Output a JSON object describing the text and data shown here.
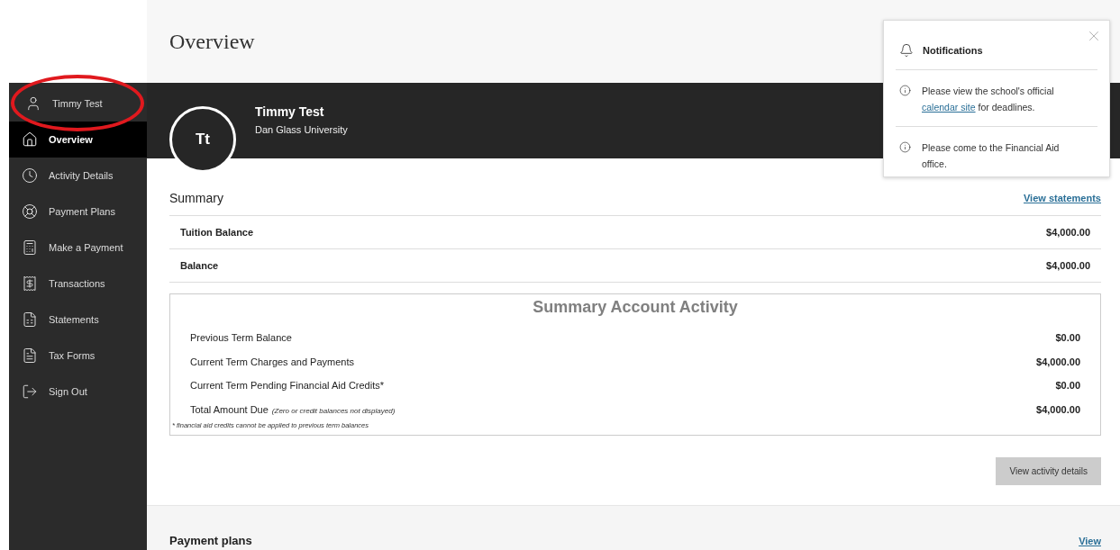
{
  "sidebar": {
    "user": "Timmy Test",
    "items": [
      {
        "label": "Overview",
        "selected": true
      },
      {
        "label": "Activity Details",
        "selected": false
      },
      {
        "label": "Payment Plans",
        "selected": false
      },
      {
        "label": "Make a Payment",
        "selected": false
      },
      {
        "label": "Transactions",
        "selected": false
      },
      {
        "label": "Statements",
        "selected": false
      },
      {
        "label": "Tax Forms",
        "selected": false
      },
      {
        "label": "Sign Out",
        "selected": false
      }
    ]
  },
  "page_title": "Overview",
  "profile": {
    "initials": "Tt",
    "name": "Timmy Test",
    "school": "Dan Glass University"
  },
  "summary": {
    "title": "Summary",
    "link": "View statements",
    "rows": [
      {
        "label": "Tuition Balance",
        "amount": "$4,000.00"
      },
      {
        "label": "Balance",
        "amount": "$4,000.00"
      }
    ]
  },
  "activity": {
    "title": "Summary Account Activity",
    "rows": [
      {
        "label": "Previous Term Balance",
        "amount": "$0.00"
      },
      {
        "label": "Current Term Charges and Payments",
        "amount": "$4,000.00"
      },
      {
        "label": "Current Term Pending Financial Aid Credits*",
        "amount": "$0.00"
      },
      {
        "label": "Total Amount Due",
        "note": "(Zero or credit balances not displayed)",
        "amount": "$4,000.00"
      }
    ],
    "footnote": "* financial aid credits cannot be applied to previous term balances"
  },
  "activity_button": "View activity details",
  "payment_plans": {
    "title": "Payment plans",
    "link": "View"
  },
  "notifications": {
    "title": "Notifications",
    "items": [
      {
        "before": "Please view the school's official ",
        "link": "calendar site",
        "after": " for deadlines."
      },
      {
        "before": "Please come to the Financial Aid office."
      }
    ]
  }
}
